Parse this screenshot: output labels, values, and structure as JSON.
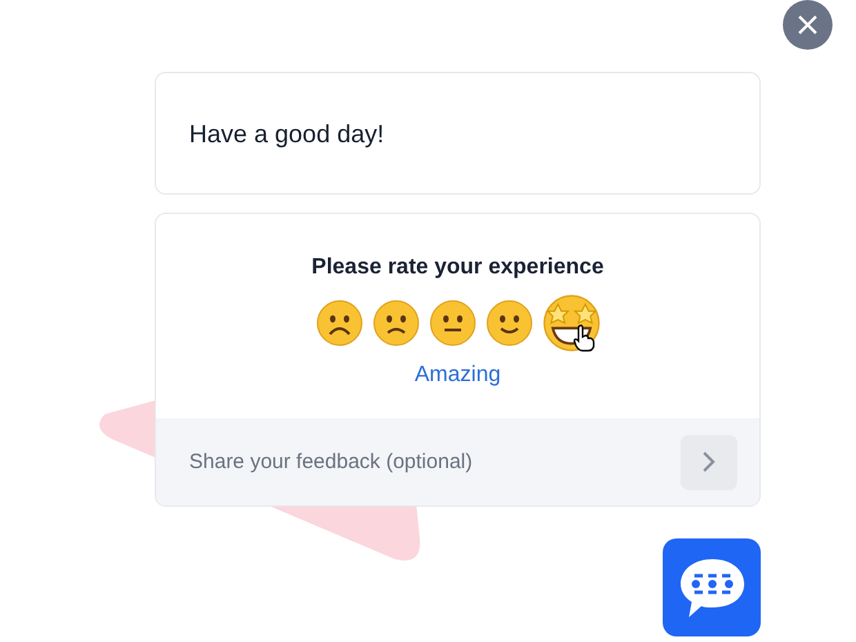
{
  "greeting": "Have a good day!",
  "rating": {
    "title": "Please rate your experience",
    "faces": [
      {
        "kind": "frowning",
        "selected": false
      },
      {
        "kind": "sad",
        "selected": false
      },
      {
        "kind": "neutral",
        "selected": false
      },
      {
        "kind": "smile",
        "selected": false
      },
      {
        "kind": "star-struck",
        "selected": true
      }
    ],
    "caption": "Amazing"
  },
  "feedback": {
    "placeholder": "Share your feedback (optional)"
  }
}
